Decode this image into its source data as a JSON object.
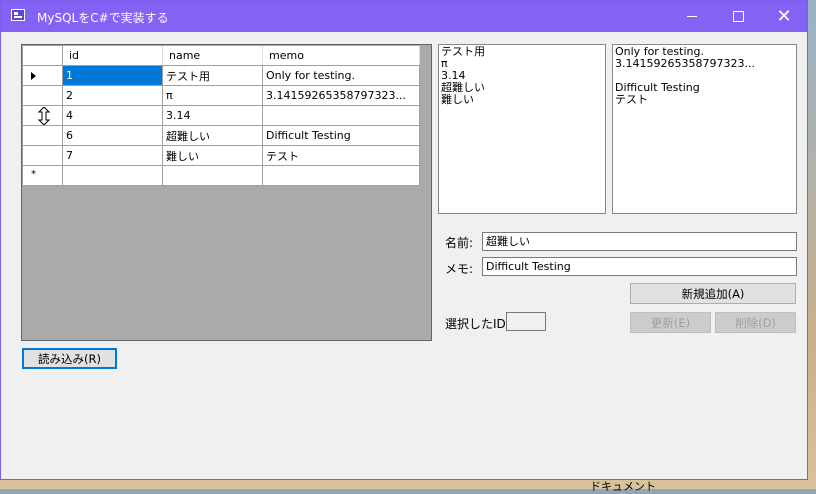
{
  "window": {
    "title": "MySQLをC#で実装する"
  },
  "grid": {
    "columns": [
      "id",
      "name",
      "memo"
    ],
    "rows": [
      [
        "1",
        "テスト用",
        "Only for testing."
      ],
      [
        "2",
        "π",
        "3.14159265358797323..."
      ],
      [
        "4",
        "3.14",
        ""
      ],
      [
        "6",
        "超難しい",
        "Difficult Testing"
      ],
      [
        "7",
        "難しい",
        "テスト"
      ]
    ],
    "new_row_marker": "*"
  },
  "name_list": [
    "テスト用",
    "π",
    "3.14",
    "超難しい",
    "難しい"
  ],
  "memo_list": [
    "Only for testing.",
    "3.14159265358797323...",
    "",
    "Difficult Testing",
    "テスト"
  ],
  "form": {
    "name_label": "名前:",
    "name_value": "超難しい",
    "memo_label": "メモ:",
    "memo_value": "Difficult Testing",
    "selected_id_label": "選択したID:",
    "selected_id_value": ""
  },
  "buttons": {
    "add": "新規追加(A)",
    "update": "更新(E)",
    "delete": "削除(D)",
    "load": "読み込み(R)"
  },
  "background": {
    "doc_label": "ドキュメント"
  },
  "colors": {
    "titlebar": "#8462f4",
    "selection": "#0078d7"
  }
}
